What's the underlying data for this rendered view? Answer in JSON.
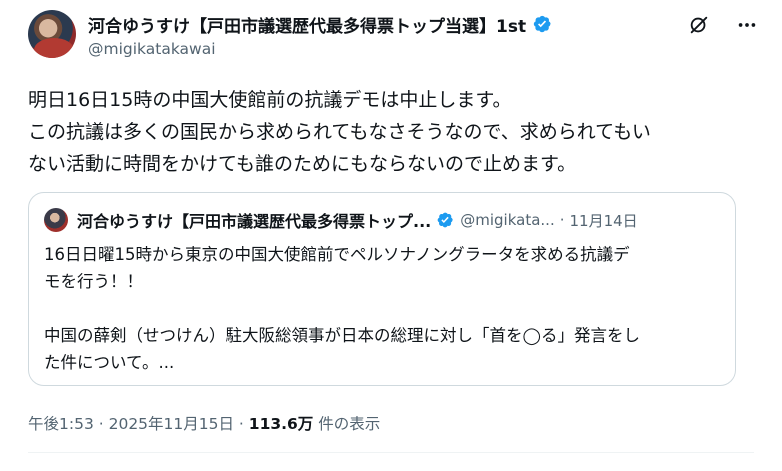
{
  "author": {
    "display_name": "河合ゆうすけ【戸田市議選歴代最多得票トップ当選】1st",
    "handle": "@migikatakawai",
    "verified_color": "#1d9bf0"
  },
  "icons": {
    "grok": "grok-icon",
    "more": "more-icon"
  },
  "tweet": {
    "line1": "明日16日15時の中国大使館前の抗議デモは中止します。",
    "line2": "この抗議は多くの国民から求められてもなさそうなので、求められてもい",
    "line3": "ない活動に時間をかけても誰のためにもならないので止めます。"
  },
  "quote": {
    "display_name": "河合ゆうすけ【戸田市議選歴代最多得票トップ...",
    "handle": "@migikata...",
    "dot": "·",
    "date": "11月14日",
    "line1": "16日日曜15時から東京の中国大使館前でペルソナノングラータを求める抗議デ",
    "line2": "モを行う！！",
    "line3": "中国の薛剣（せつけん）駐大阪総領事が日本の総理に対し「首を◯る」発言をし",
    "line4": "た件について。..."
  },
  "meta": {
    "time": "午後1:53",
    "sep1": " · ",
    "date": "2025年11月15日",
    "sep2": " · ",
    "views_count": "113.6万",
    "views_label": " 件の表示"
  }
}
